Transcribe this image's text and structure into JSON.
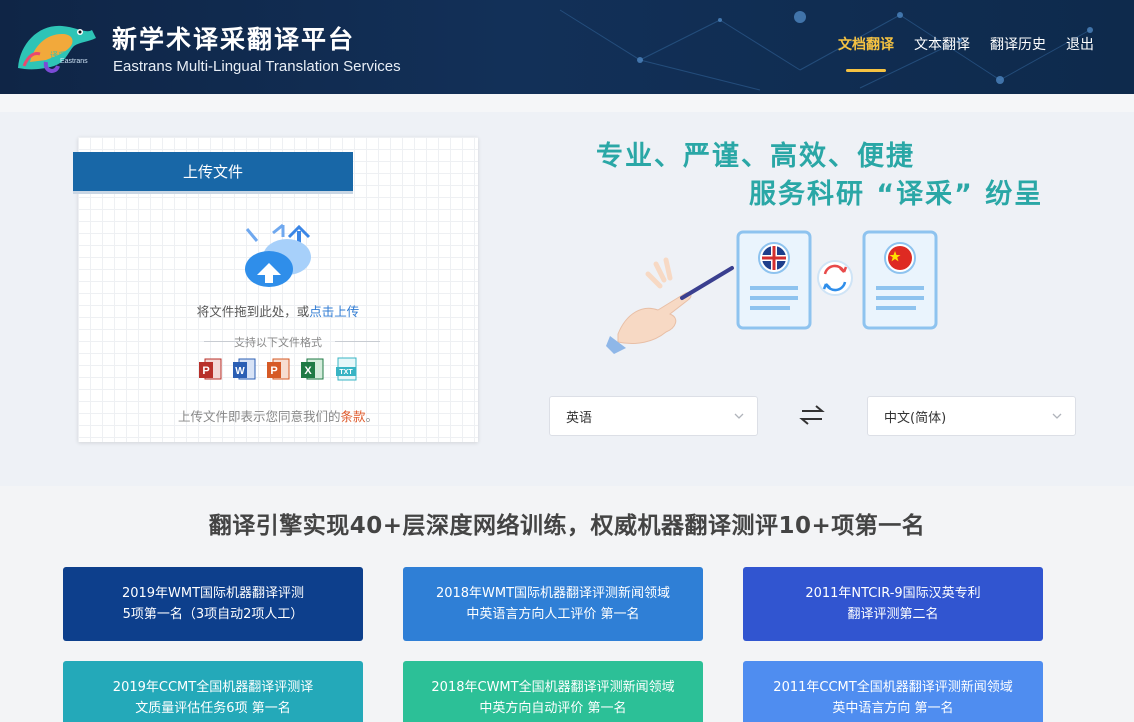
{
  "header": {
    "title": "新学术译采翻译平台",
    "subtitle": "Eastrans Multi-Lingual Translation Services",
    "logo_text": "译采",
    "logo_subtext": "Eastrans"
  },
  "nav": {
    "items": [
      {
        "label": "文档翻译",
        "active": true
      },
      {
        "label": "文本翻译",
        "active": false
      },
      {
        "label": "翻译历史",
        "active": false
      },
      {
        "label": "退出",
        "active": false
      }
    ]
  },
  "upload": {
    "header": "上传文件",
    "drop_text": "将文件拖到此处，或",
    "drop_link": "点击上传",
    "formats_label": "支持以下文件格式",
    "formats": [
      {
        "name": "pdf-icon",
        "letter": "P",
        "color": "#b8302a"
      },
      {
        "name": "word-icon",
        "letter": "W",
        "color": "#2b5fb4"
      },
      {
        "name": "powerpoint-icon",
        "letter": "P",
        "color": "#d65a26"
      },
      {
        "name": "excel-icon",
        "letter": "X",
        "color": "#1f7a45"
      },
      {
        "name": "txt-icon",
        "letter": "TXT",
        "color": "#38b4c4"
      }
    ],
    "terms_text": "上传文件即表示您同意我们的",
    "terms_link": "条款",
    "terms_end": "。"
  },
  "hero": {
    "slogan_line1": "专业、严谨、高效、便捷",
    "slogan_line2": "服务科研 “译采” 纷呈"
  },
  "language": {
    "source": "英语",
    "target": "中文(简体)"
  },
  "awards": {
    "title": "翻译引擎实现40+层深度网络训练，权威机器翻译测评10+项第一名",
    "items": [
      {
        "line1": "2019年WMT国际机器翻译评测",
        "line2": "5项第一名（3项自动2项人工）",
        "color": "#0d3f8c"
      },
      {
        "line1": "2018年WMT国际机器翻译评测新闻领域",
        "line2": "中英语言方向人工评价 第一名",
        "color": "#2f7fd6"
      },
      {
        "line1": "2011年NTCIR-9国际汉英专利",
        "line2": "翻译评测第二名",
        "color": "#3155d0"
      },
      {
        "line1": "2019年CCMT全国机器翻译评测译",
        "line2": "文质量评估任务6项 第一名",
        "color": "#24a9b9"
      },
      {
        "line1": "2018年CWMT全国机器翻译评测新闻领域",
        "line2": "中英方向自动评价 第一名",
        "color": "#2cc097"
      },
      {
        "line1": "2011年CCMT全国机器翻译评测新闻领域",
        "line2": "英中语言方向 第一名",
        "color": "#4f8df0"
      }
    ]
  }
}
